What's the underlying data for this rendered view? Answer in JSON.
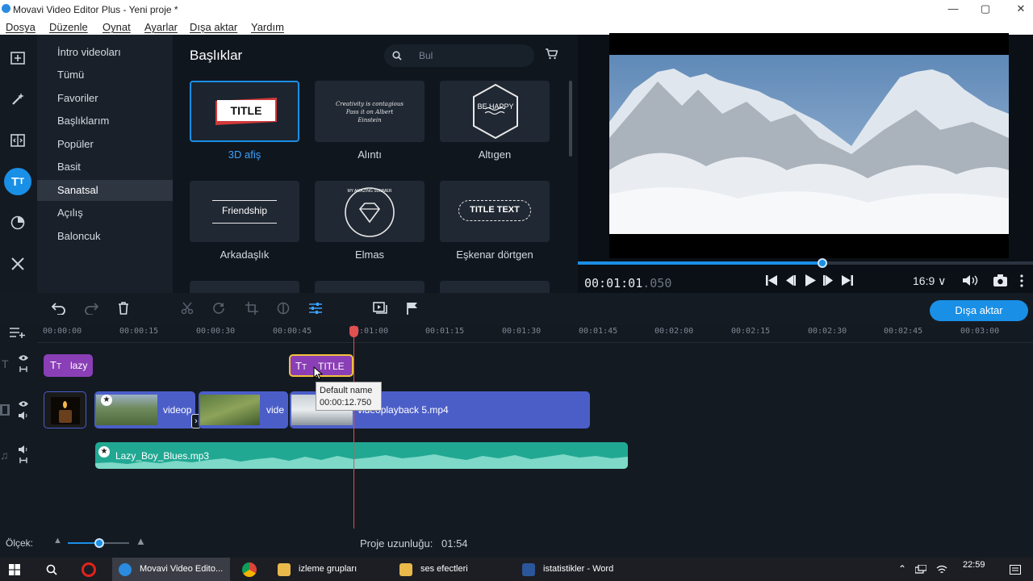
{
  "window": {
    "title": "Movavi Video Editor Plus - Yeni proje *",
    "minimize": "—",
    "maximize": "▢",
    "close": "✕"
  },
  "menu": [
    "Dosya",
    "Düzenle",
    "Oynat",
    "Ayarlar",
    "Dışa aktar",
    "Yardım"
  ],
  "categories": [
    "İntro videoları",
    "Tümü",
    "Favoriler",
    "Başlıklarım",
    "Popüler",
    "Basit",
    "Sanatsal",
    "Açılış",
    "Baloncuk"
  ],
  "selected_category": "Sanatsal",
  "gallery": {
    "heading": "Başlıklar",
    "search_placeholder": "Bul",
    "items": [
      {
        "label": "3D afiş",
        "preview": "TITLE"
      },
      {
        "label": "Alıntı",
        "preview": "Creativity is contagious Pass it on Albert Einstein"
      },
      {
        "label": "Altıgen",
        "preview": "BE HAPPY"
      },
      {
        "label": "Arkadaşlık",
        "preview": "Friendship"
      },
      {
        "label": "Elmas",
        "preview": "MY AMAZING SUMMER"
      },
      {
        "label": "Eşkenar dörtgen",
        "preview": "TITLE TEXT"
      }
    ]
  },
  "preview": {
    "timecode": "00:01:01",
    "timecode_ms": ".050",
    "aspect": "16:9 ∨",
    "progress_fraction": 0.537
  },
  "toolbar": {
    "export_label": "Dışa aktar"
  },
  "ruler": [
    "00:00:00",
    "00:00:15",
    "00:00:30",
    "00:00:45",
    "00:01:00",
    "00:01:15",
    "00:01:30",
    "00:01:45",
    "00:02:00",
    "00:02:15",
    "00:02:30",
    "00:02:45",
    "00:03:00"
  ],
  "clips": {
    "title1": "lazy",
    "title2": "TITLE",
    "video2": "videop",
    "video3": "vide",
    "video4": "videoplayback 5.mp4",
    "audio": "Lazy_Boy_Blues.mp3"
  },
  "tooltip": {
    "name": "Default name",
    "time": "00:00:12.750"
  },
  "status": {
    "scale_label": "Ölçek:",
    "length_label": "Proje uzunluğu:",
    "length_value": "01:54"
  },
  "taskbar": {
    "items": [
      "Movavi Video Edito...",
      "izleme grupları",
      "ses efectleri",
      "istatistikler - Word"
    ],
    "clock": "22:59"
  }
}
